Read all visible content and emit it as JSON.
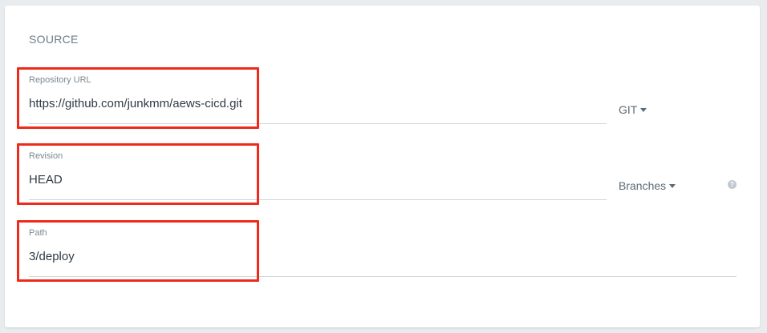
{
  "section": {
    "title": "SOURCE"
  },
  "fields": {
    "repository_url": {
      "label": "Repository URL",
      "value": "https://github.com/junkmm/aews-cicd.git",
      "type_dropdown": "GIT"
    },
    "revision": {
      "label": "Revision",
      "value": "HEAD",
      "type_dropdown": "Branches"
    },
    "path": {
      "label": "Path",
      "value": "3/deploy"
    }
  },
  "icons": {
    "dropdown_caret": "caret-down-icon",
    "help": "question-circle-icon"
  },
  "colors": {
    "highlight": "#ee2b1a",
    "text": "#2f3a45",
    "muted": "#6b7a88"
  }
}
